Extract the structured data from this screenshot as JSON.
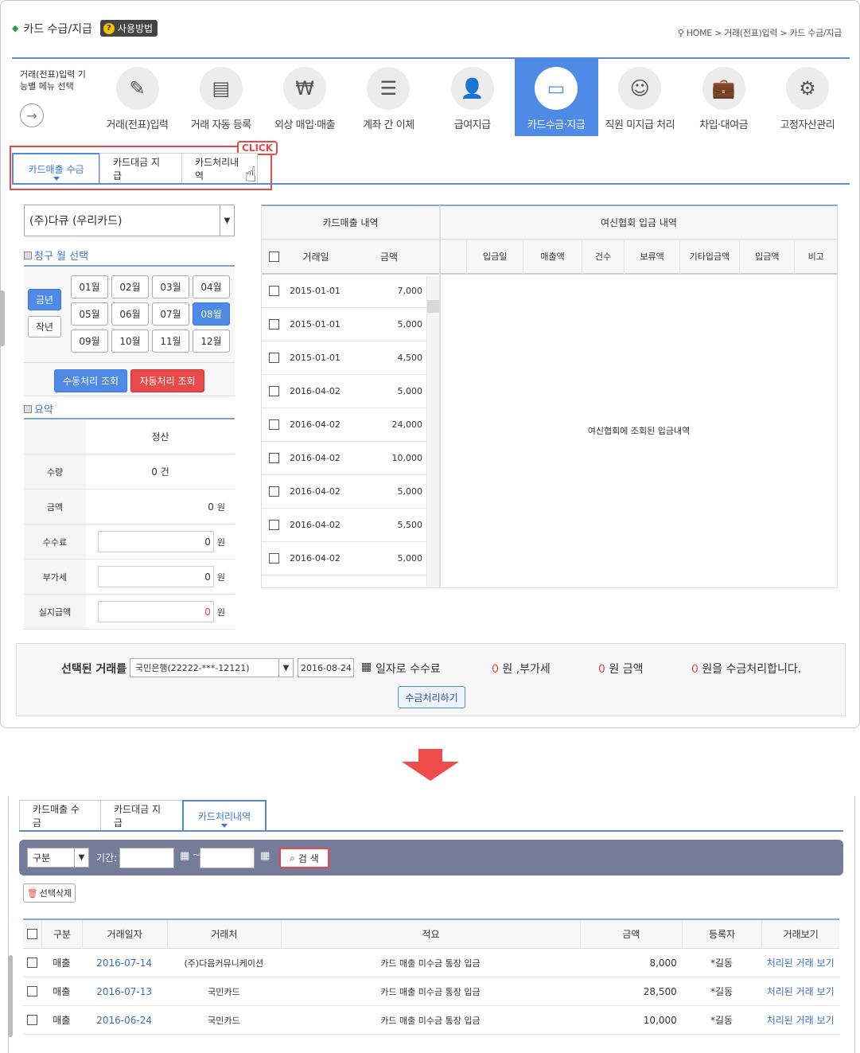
{
  "page": {
    "title": "카드 수급/지급",
    "howto_label": "사용방법",
    "breadcrumb": "HOME > 거래(전표)입력 > 카드 수금/지급"
  },
  "menu": {
    "left_label": "거래(전표)입력 기능별 메뉴 선택",
    "items": [
      {
        "label": "거래(전표)입력",
        "icon": "document-pen-icon"
      },
      {
        "label": "거래 자동 등록",
        "icon": "server-icon"
      },
      {
        "label": "외상 매입·매출",
        "icon": "money-icon"
      },
      {
        "label": "계좌 간 이체",
        "icon": "ledger-icon"
      },
      {
        "label": "급여지급",
        "icon": "person-icon"
      },
      {
        "label": "카드수금·지급",
        "icon": "credit-card-icon"
      },
      {
        "label": "직원 미지급 처리",
        "icon": "staff-icon"
      },
      {
        "label": "차입·대여금",
        "icon": "briefcase-icon"
      },
      {
        "label": "고정자산관리",
        "icon": "asset-doc-icon"
      }
    ]
  },
  "tabs": [
    "카드매출 수금",
    "카드대금 지급",
    "카드처리내역"
  ],
  "click_label": "CLICK",
  "card_select": "(주)다큐 (우리카드)",
  "month_section": {
    "title": "청구 월 선택",
    "this_year": "금년",
    "last_year": "작년",
    "months": [
      "01월",
      "02월",
      "03월",
      "04월",
      "05월",
      "06월",
      "07월",
      "08월",
      "09월",
      "10월",
      "11월",
      "12월"
    ],
    "selected_month": "08월",
    "manual_btn": "수동처리 조회",
    "auto_btn": "자동처리 조회"
  },
  "summary": {
    "title": "요약",
    "col": "정산",
    "rows": [
      {
        "label": "수량",
        "value": "0 건"
      },
      {
        "label": "금액",
        "value": "0",
        "unit": "원"
      },
      {
        "label": "수수료",
        "value": "0",
        "unit": "원"
      },
      {
        "label": "부가세",
        "value": "0",
        "unit": "원"
      },
      {
        "label": "실지급액",
        "value": "0",
        "unit": "원"
      }
    ]
  },
  "sales_table": {
    "group": "카드매출 내역",
    "cols": [
      "거래일",
      "금액"
    ],
    "rows": [
      {
        "date": "2015-01-01",
        "amount": "7,000"
      },
      {
        "date": "2015-01-01",
        "amount": "5,000"
      },
      {
        "date": "2015-01-01",
        "amount": "4,500"
      },
      {
        "date": "2016-04-02",
        "amount": "5,000"
      },
      {
        "date": "2016-04-02",
        "amount": "24,000"
      },
      {
        "date": "2016-04-02",
        "amount": "10,000"
      },
      {
        "date": "2016-04-02",
        "amount": "5,000"
      },
      {
        "date": "2016-04-02",
        "amount": "5,500"
      },
      {
        "date": "2016-04-02",
        "amount": "5,000"
      }
    ]
  },
  "deposit_table": {
    "group": "여신협회 입금 내역",
    "cols": [
      "입금일",
      "매출액",
      "건수",
      "보류액",
      "기타입금액",
      "입금액",
      "비고"
    ],
    "empty": "여신협회에 조회된 입금내역"
  },
  "bottom": {
    "label": "선택된 거래를",
    "account": "국민은행(22222-***-12121)",
    "date": "2016-08-24",
    "fee_label": "일자로 수수료",
    "fee_val": "0",
    "vat_label": "원 ,부가세",
    "vat_val": "0",
    "amt_label": "원 금액",
    "amt_val": "0",
    "end_label": "원을 수금처리합니다.",
    "btn": "수금처리하기"
  },
  "history": {
    "filter_select": "구분",
    "period_label": "기간:",
    "tilde": "~",
    "search_btn": "검 색",
    "delete_btn": "선택삭제",
    "cols": [
      "구분",
      "거래일자",
      "거래처",
      "적요",
      "금액",
      "등록자",
      "거래보기"
    ],
    "rows": [
      {
        "type": "매출",
        "date": "2016-07-14",
        "client": "(주)다음커뮤니케이션",
        "memo": "카드 매출 미수금 통장 입금",
        "amount": "8,000",
        "user": "*길동",
        "link": "처리된 거래 보기"
      },
      {
        "type": "매출",
        "date": "2016-07-13",
        "client": "국민카드",
        "memo": "카드 매출 미수금 통장 입금",
        "amount": "28,500",
        "user": "*길동",
        "link": "처리된 거래 보기"
      },
      {
        "type": "매출",
        "date": "2016-06-24",
        "client": "국민카드",
        "memo": "카드 매출 미수금 통장 입금",
        "amount": "10,000",
        "user": "*길동",
        "link": "처리된 거래 보기"
      }
    ]
  },
  "colors": {
    "accent": "#4f8ae6",
    "red": "#e84a4a",
    "filterbar": "#747c99"
  }
}
